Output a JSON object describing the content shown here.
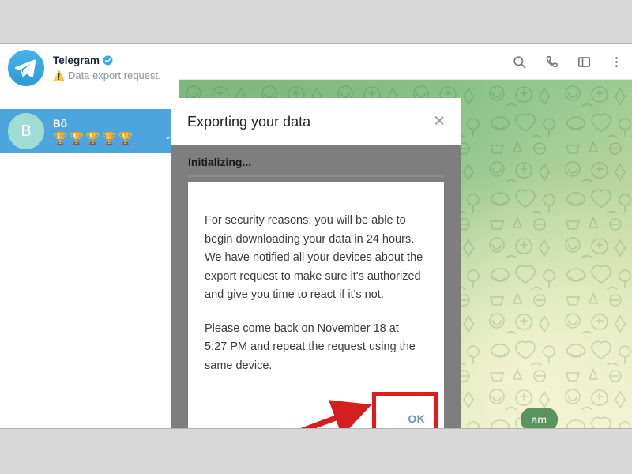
{
  "app": {
    "name": "Telegram Desktop"
  },
  "chat_list": {
    "items": [
      {
        "name": "telegram-service",
        "title": "Telegram",
        "verified": true,
        "preview": "Data export request.",
        "warning_icon": "⚠️",
        "avatar_type": "telegram-logo",
        "selected": false
      },
      {
        "name": "bo",
        "title": "Bố",
        "verified": false,
        "preview": "🏆🏆🏆🏆🏆",
        "avatar_letter": "B",
        "avatar_type": "letter",
        "selected": true
      }
    ]
  },
  "chat_header": {
    "icons": [
      {
        "name": "search-icon",
        "label": "Search"
      },
      {
        "name": "phone-icon",
        "label": "Call"
      },
      {
        "name": "panel-icon",
        "label": "Toggle info panel"
      },
      {
        "name": "more-vertical-icon",
        "label": "More"
      }
    ]
  },
  "chat_messages": {
    "visible_bubble_text": "am"
  },
  "dialog": {
    "title": "Exporting your data",
    "close_label": "✕",
    "status": "Initializing...",
    "progress_percent": 0,
    "paragraphs": [
      "For security reasons, you will be able to begin downloading your data in 24 hours. We have notified all your devices about the export request to make sure it's authorized and give you time to react if it's not.",
      "Please come back on November 18 at 5:27 PM and repeat the request using the same device."
    ],
    "ok_label": "OK"
  },
  "annotations": {
    "highlight_color": "#e01b1b",
    "arrow_color": "#d31f1f",
    "target": "ok-button"
  },
  "colors": {
    "telegram_blue": "#4ca6dd",
    "overlay_gray": "#7e7e7e",
    "wallpaper_green": "#8cc08a",
    "ok_text": "#7591a3"
  }
}
